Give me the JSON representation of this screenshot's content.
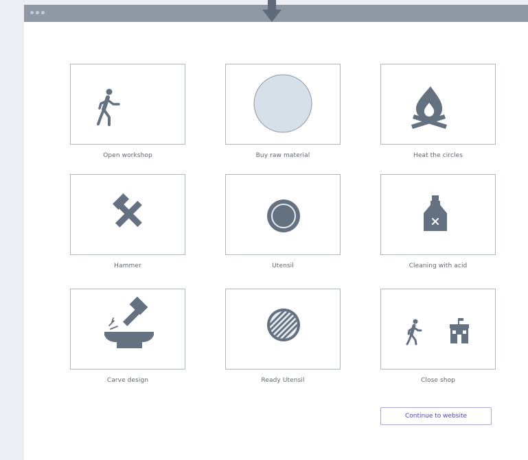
{
  "colors": {
    "icon": "#637181",
    "frame": "#aeb6c2",
    "titlebar": "#8f99a6",
    "accent": "#4a40d8",
    "disc_fill": "#d6e0e8"
  },
  "steps": [
    {
      "label": "Open workshop",
      "icon": "walking-person-icon"
    },
    {
      "label": "Buy raw material",
      "icon": "raw-material-disc-icon"
    },
    {
      "label": "Heat the circles",
      "icon": "fire-icon"
    },
    {
      "label": "Hammer",
      "icon": "hammer-icon"
    },
    {
      "label": "Utensil",
      "icon": "utensil-disc-icon"
    },
    {
      "label": "Cleaning with acid",
      "icon": "acid-bottle-icon"
    },
    {
      "label": "Carve design",
      "icon": "carving-icon"
    },
    {
      "label": "Ready Utensil",
      "icon": "ready-utensil-icon"
    },
    {
      "label": "Close shop",
      "icon": "close-shop-icon"
    }
  ],
  "continue_button": {
    "label": "Continue to website"
  }
}
